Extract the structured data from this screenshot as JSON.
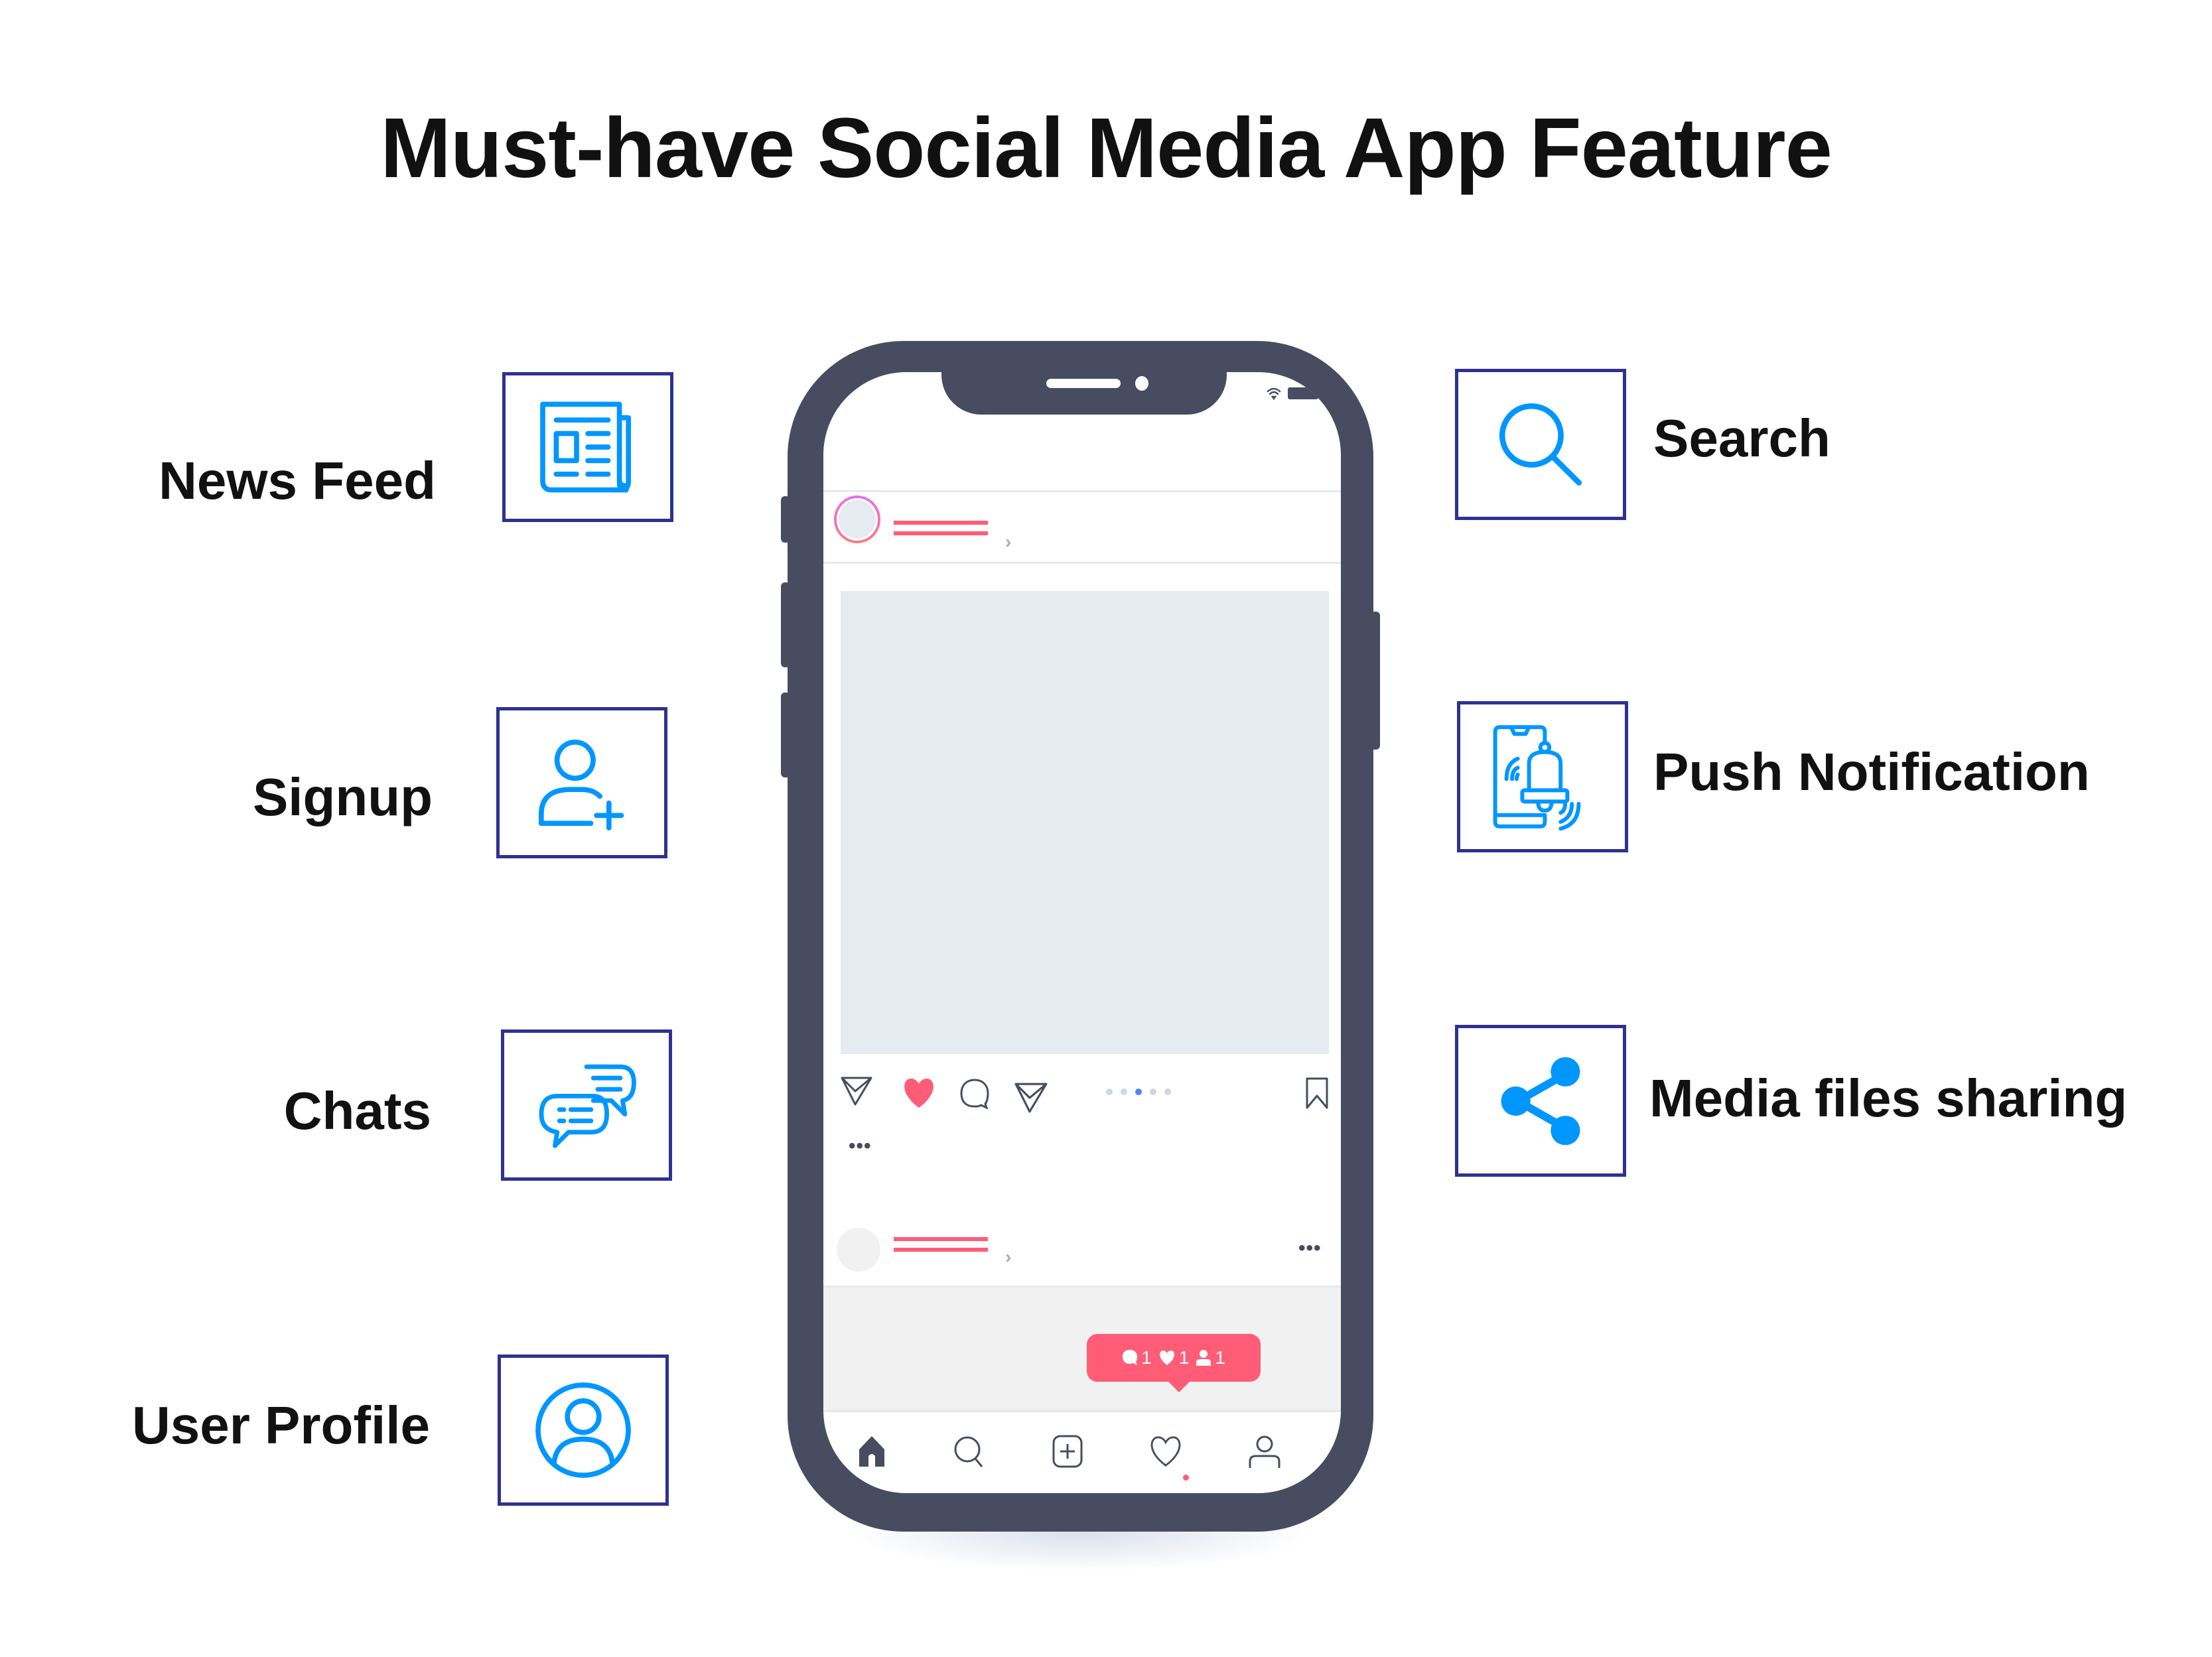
{
  "title": "Must-have Social Media App Feature",
  "colors": {
    "icon_blue": "#0096ff",
    "box_border": "#2e3192",
    "phone_body": "#474c61",
    "accent_pink": "#ff5c77",
    "carousel_active": "#4c84f4"
  },
  "features_left": [
    {
      "label": "News Feed",
      "icon": "newspaper-icon"
    },
    {
      "label": "Signup",
      "icon": "add-user-icon"
    },
    {
      "label": "Chats",
      "icon": "chat-bubbles-icon"
    },
    {
      "label": "User Profile",
      "icon": "user-circle-icon"
    }
  ],
  "features_right": [
    {
      "label": "Search",
      "icon": "search-icon"
    },
    {
      "label": "Push Notification",
      "icon": "phone-bell-icon"
    },
    {
      "label": "Media files sharing",
      "icon": "share-icon"
    }
  ],
  "phone": {
    "carousel": {
      "count": 5,
      "active_index": 2
    },
    "notification_badge": {
      "comments": "1",
      "likes": "1",
      "followers": "1"
    },
    "post_more": "•••",
    "caption_more": "•••",
    "chevron": "›",
    "tabs": [
      "home-icon",
      "search-icon",
      "add-post-icon",
      "activity-heart-icon",
      "profile-icon"
    ],
    "active_notification_tab": "activity-heart-icon"
  }
}
